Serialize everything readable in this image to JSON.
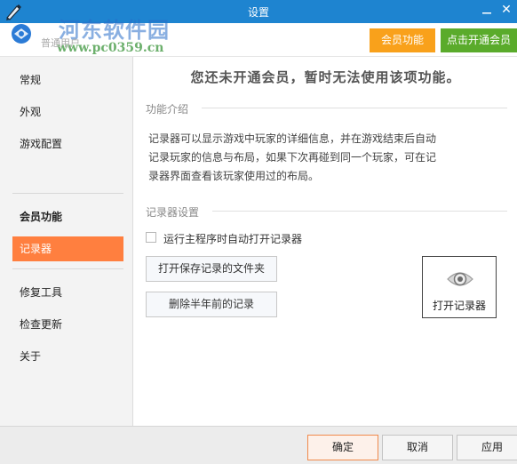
{
  "window": {
    "title": "设置",
    "minimize_glyph": "—",
    "close_glyph": "✕"
  },
  "header": {
    "user_label": "普通用户",
    "watermark_name": "河东软件园",
    "watermark_url": "www.pc0359.cn",
    "member_button": "会员功能",
    "open_member_button": "点击开通会员"
  },
  "sidebar": {
    "items": [
      {
        "label": "常规"
      },
      {
        "label": "外观"
      },
      {
        "label": "游戏配置"
      },
      {
        "label": "会员功能"
      },
      {
        "label": "记录器"
      },
      {
        "label": "修复工具"
      },
      {
        "label": "检查更新"
      },
      {
        "label": "关于"
      }
    ],
    "active_index": 4
  },
  "main": {
    "notice": "您还未开通会员，暂时无法使用该项功能。",
    "intro_title": "功能介绍",
    "intro_lines": [
      "记录器可以显示游戏中玩家的详细信息，并在游戏结束后自动",
      "记录玩家的信息与布局，如果下次再碰到同一个玩家，可在记",
      "录器界面查看该玩家使用过的布局。"
    ],
    "settings_title": "记录器设置",
    "auto_open_label": "运行主程序时自动打开记录器",
    "auto_open_checked": false,
    "open_folder_button": "打开保存记录的文件夹",
    "delete_old_button": "删除半年前的记录",
    "open_recorder_label": "打开记录器"
  },
  "footer": {
    "ok": "确定",
    "cancel": "取消",
    "apply": "应用"
  },
  "colors": {
    "titlebar": "#1e84d0",
    "member_orange": "#f9a11b",
    "open_green": "#5aab2b",
    "active_item": "#ff7f3f"
  }
}
